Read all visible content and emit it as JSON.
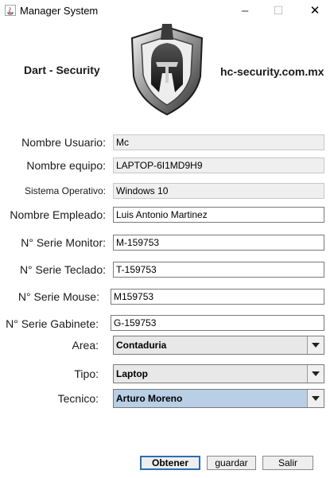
{
  "window": {
    "title": "Manager System"
  },
  "header": {
    "brand_left": "Dart - Security",
    "brand_right": "hc-security.com.mx"
  },
  "form": {
    "usuario": {
      "label": "Nombre Usuario:",
      "value": "Mc"
    },
    "equipo": {
      "label": "Nombre equipo:",
      "value": "LAPTOP-6I1MD9H9"
    },
    "so": {
      "label": "Sistema Operativo:",
      "value": "Windows 10"
    },
    "empleado": {
      "label": "Nombre Empleado:",
      "value": "Luis Antonio Martinez"
    },
    "monitor": {
      "label": "N° Serie Monitor:",
      "value": "M-159753"
    },
    "teclado": {
      "label": "N° Serie Teclado:",
      "value": "T-159753"
    },
    "mouse": {
      "label": "N° Serie Mouse:",
      "value": "M159753"
    },
    "gabinete": {
      "label": "N° Serie Gabinete:",
      "value": "G-159753"
    },
    "area": {
      "label": "Area:",
      "value": "Contaduria"
    },
    "tipo": {
      "label": "Tipo:",
      "value": "Laptop"
    },
    "tecnico": {
      "label": "Tecnico:",
      "value": "Arturo Moreno"
    }
  },
  "buttons": {
    "obtener": "Obtener",
    "guardar": "guardar",
    "salir": "Salir"
  },
  "colors": {
    "selected_combo": "#b8cfe5",
    "focus_border": "#2e6db4"
  }
}
